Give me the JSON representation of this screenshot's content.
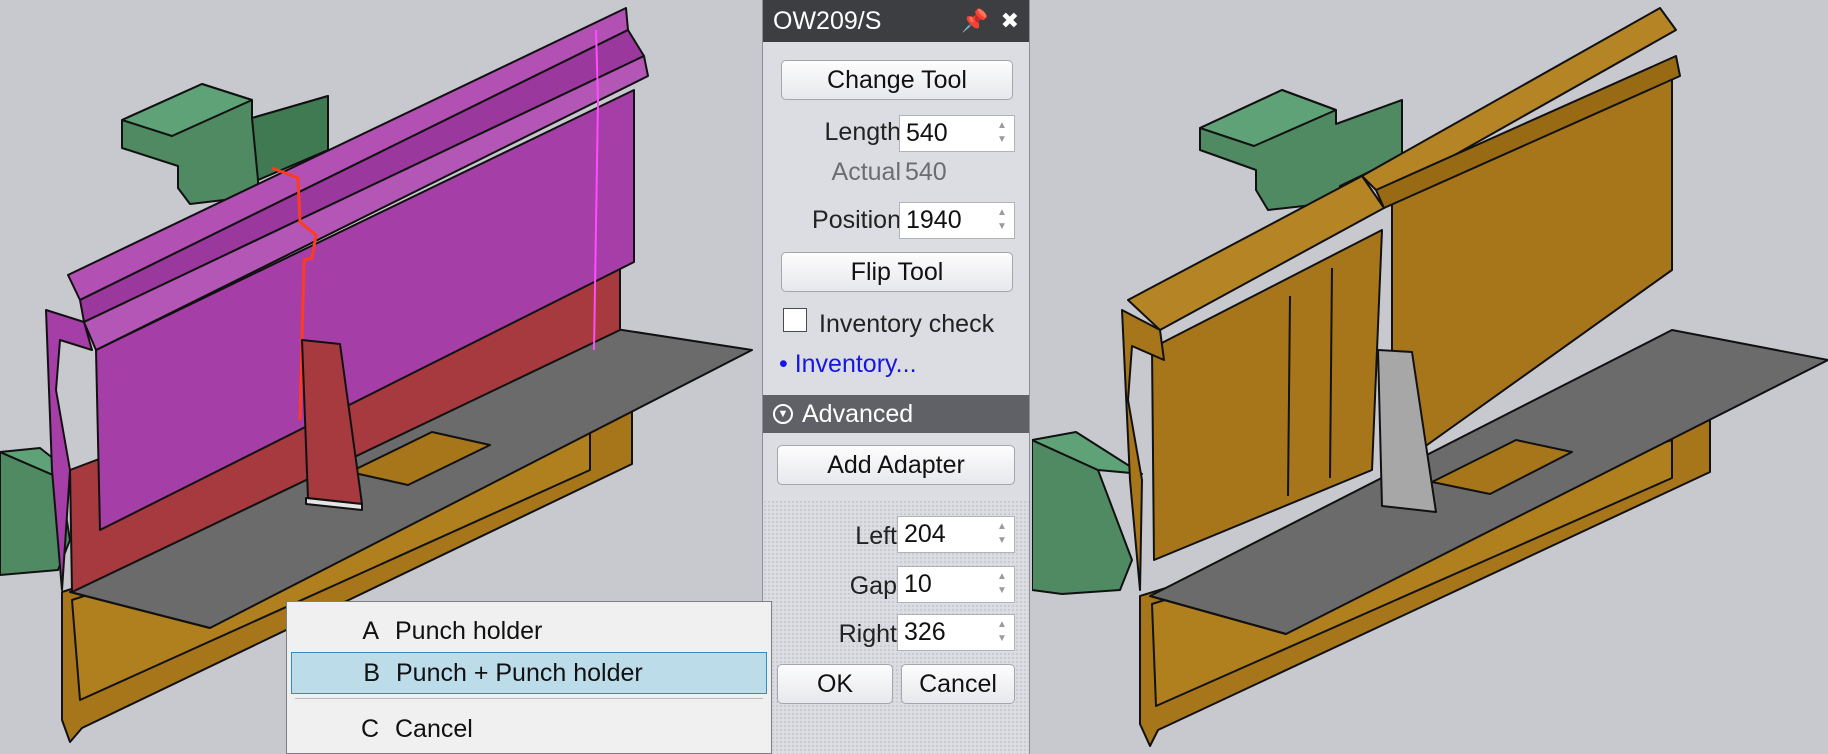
{
  "panel": {
    "title": "OW209/S",
    "change_tool_label": "Change Tool",
    "length_label": "Length",
    "length_value": "540",
    "actual_label": "Actual",
    "actual_value": "540",
    "position_label": "Position",
    "position_value": "1940",
    "flip_tool_label": "Flip Tool",
    "inventory_check_label": "Inventory check",
    "inventory_check_checked": false,
    "inventory_link": "• Inventory...",
    "advanced_label": "Advanced",
    "add_adapter_label": "Add Adapter",
    "left_label": "Left",
    "left_value": "204",
    "gap_label": "Gap",
    "gap_value": "10",
    "right_label": "Right",
    "right_value": "326",
    "ok_label": "OK",
    "cancel_label": "Cancel"
  },
  "context_menu": {
    "items": [
      {
        "key": "A",
        "label": "Punch holder",
        "highlighted": false
      },
      {
        "key": "B",
        "label": "Punch + Punch holder",
        "highlighted": true
      },
      {
        "key": "C",
        "label": "Cancel",
        "highlighted": false
      }
    ]
  },
  "colors": {
    "background": "#c8c9cf",
    "punch_holder_selected": "#a63ea8",
    "punch_selected": "#a63a3e",
    "tool_orange": "#a8761a",
    "clamp_green": "#4f8a62",
    "sheet_gray": "#6b6b6b",
    "highlight_edge": "#ff3b1f",
    "menu_highlight": "#bcdcea",
    "link_blue": "#1515e6"
  },
  "icons": {
    "pin": "pin-icon",
    "close": "close-icon",
    "expand": "chevron-down-circle-icon"
  }
}
